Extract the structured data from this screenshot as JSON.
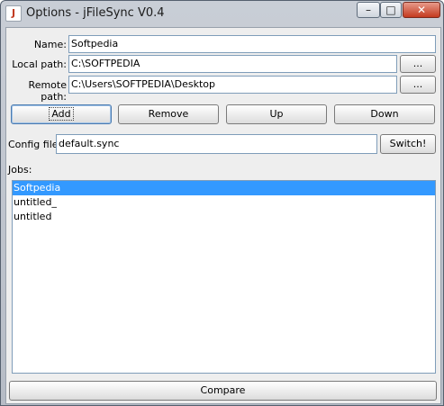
{
  "window": {
    "title": "Options - jFileSync V0.4"
  },
  "form": {
    "name_label": "Name:",
    "name_value": "Softpedia",
    "local_label": "Local path:",
    "local_value": "C:\\SOFTPEDIA",
    "remote_label": "Remote path:",
    "remote_value": "C:\\Users\\SOFTPEDIA\\Desktop",
    "browse_label": "...",
    "config_label": "Config file:",
    "config_value": "default.sync",
    "switch_label": "Switch!"
  },
  "actions": {
    "add": "Add",
    "remove": "Remove",
    "up": "Up",
    "down": "Down"
  },
  "jobs": {
    "label": "Jobs:",
    "items": [
      "Softpedia",
      "untitled_",
      "untitled"
    ],
    "selected": "Softpedia"
  },
  "compare_label": "Compare"
}
